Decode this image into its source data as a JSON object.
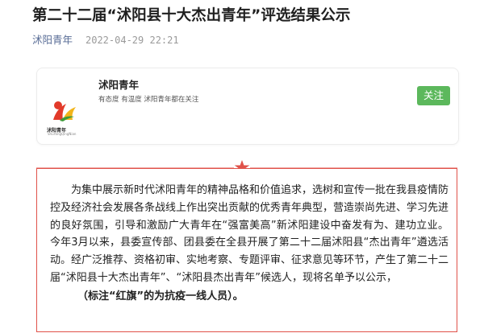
{
  "article": {
    "title": "第二十二届“沭阳县十大杰出青年”评选结果公示",
    "account": "沭阳青年",
    "datetime": "2022-04-29 22:21"
  },
  "profile_card": {
    "name": "沭阳青年",
    "description": "有态度 有温度 沭阳青年都在关注",
    "follow_label": "关注",
    "logo_text": "沭阳青年",
    "logo_subtext": "ShuYangQingNian",
    "logo_colors": {
      "red": "#e23a2a",
      "yellow": "#f2b51a",
      "green": "#3f9b3a"
    },
    "follow_color": "#5cb85c"
  },
  "divider": {
    "icon": "star-icon",
    "color": "#e0524a"
  },
  "content": {
    "paragraph": "为集中展示新时代沭阳青年的精神品格和价值追求，选树和宣传一批在我县疫情防控及经济社会发展各条战线上作出突出贡献的优秀青年典型，营造崇尚先进、学习先进的良好氛围，引导和激励广大青年在“强富美高”新沭阳建设中奋发有为、建功立业。今年3月以来，县委宣传部、团县委在全县开展了第二十二届沭阳县“杰出青年”遴选活动。经广泛推荐、资格初审、实地考察、专题评审、征求意见等环节，产生了第二十二届“沭阳县十大杰出青年”、“沭阳县杰出青年”候选人，现将名单予以公示，",
    "note": "（标注“红旗”的为抗疫一线人员）。"
  }
}
